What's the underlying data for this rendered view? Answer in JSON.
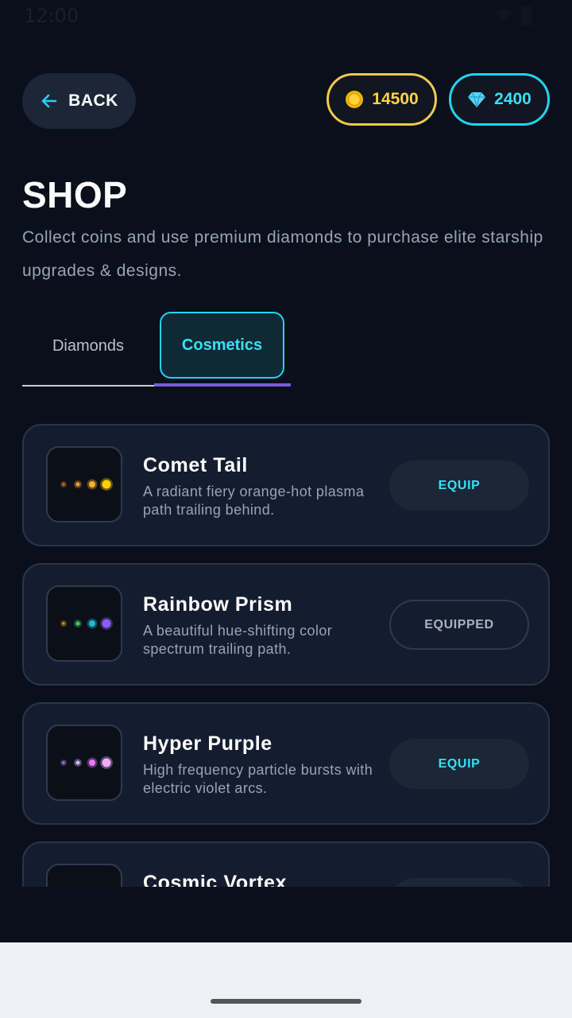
{
  "status": {
    "time": "12:00"
  },
  "header": {
    "back_label": "BACK",
    "coins": "14500",
    "diamonds": "2400"
  },
  "page": {
    "title": "SHOP",
    "subtitle": "Collect coins and use premium diamonds to purchase elite starship upgrades & designs."
  },
  "tabs": [
    {
      "label": "Diamonds",
      "active": false
    },
    {
      "label": "Cosmetics",
      "active": true
    }
  ],
  "items": [
    {
      "name": "Comet Tail",
      "description": "A radiant fiery orange-hot plasma path trailing behind.",
      "action": "EQUIP",
      "state": "equip",
      "icon": "comet-tail-icon",
      "colors": [
        "#ff7a1a",
        "#ff9a2a",
        "#ffb020",
        "#ffd000"
      ]
    },
    {
      "name": "Rainbow Prism",
      "description": "A beautiful hue-shifting color spectrum trailing path.",
      "action": "EQUIPPED",
      "state": "equipped",
      "icon": "rainbow-prism-icon",
      "colors": [
        "#f5a623",
        "#3fcf5a",
        "#22b8cf",
        "#8b5cf6"
      ]
    },
    {
      "name": "Hyper Purple",
      "description": "High frequency particle bursts with electric violet arcs.",
      "action": "EQUIP",
      "state": "equip",
      "icon": "hyper-purple-icon",
      "colors": [
        "#c084fc",
        "#d8b4fe",
        "#e879f9",
        "#f0abfc"
      ]
    },
    {
      "name": "Cosmic Vortex",
      "description": "",
      "action": "",
      "state": "equip",
      "icon": "cosmic-vortex-icon",
      "colors": []
    }
  ]
}
